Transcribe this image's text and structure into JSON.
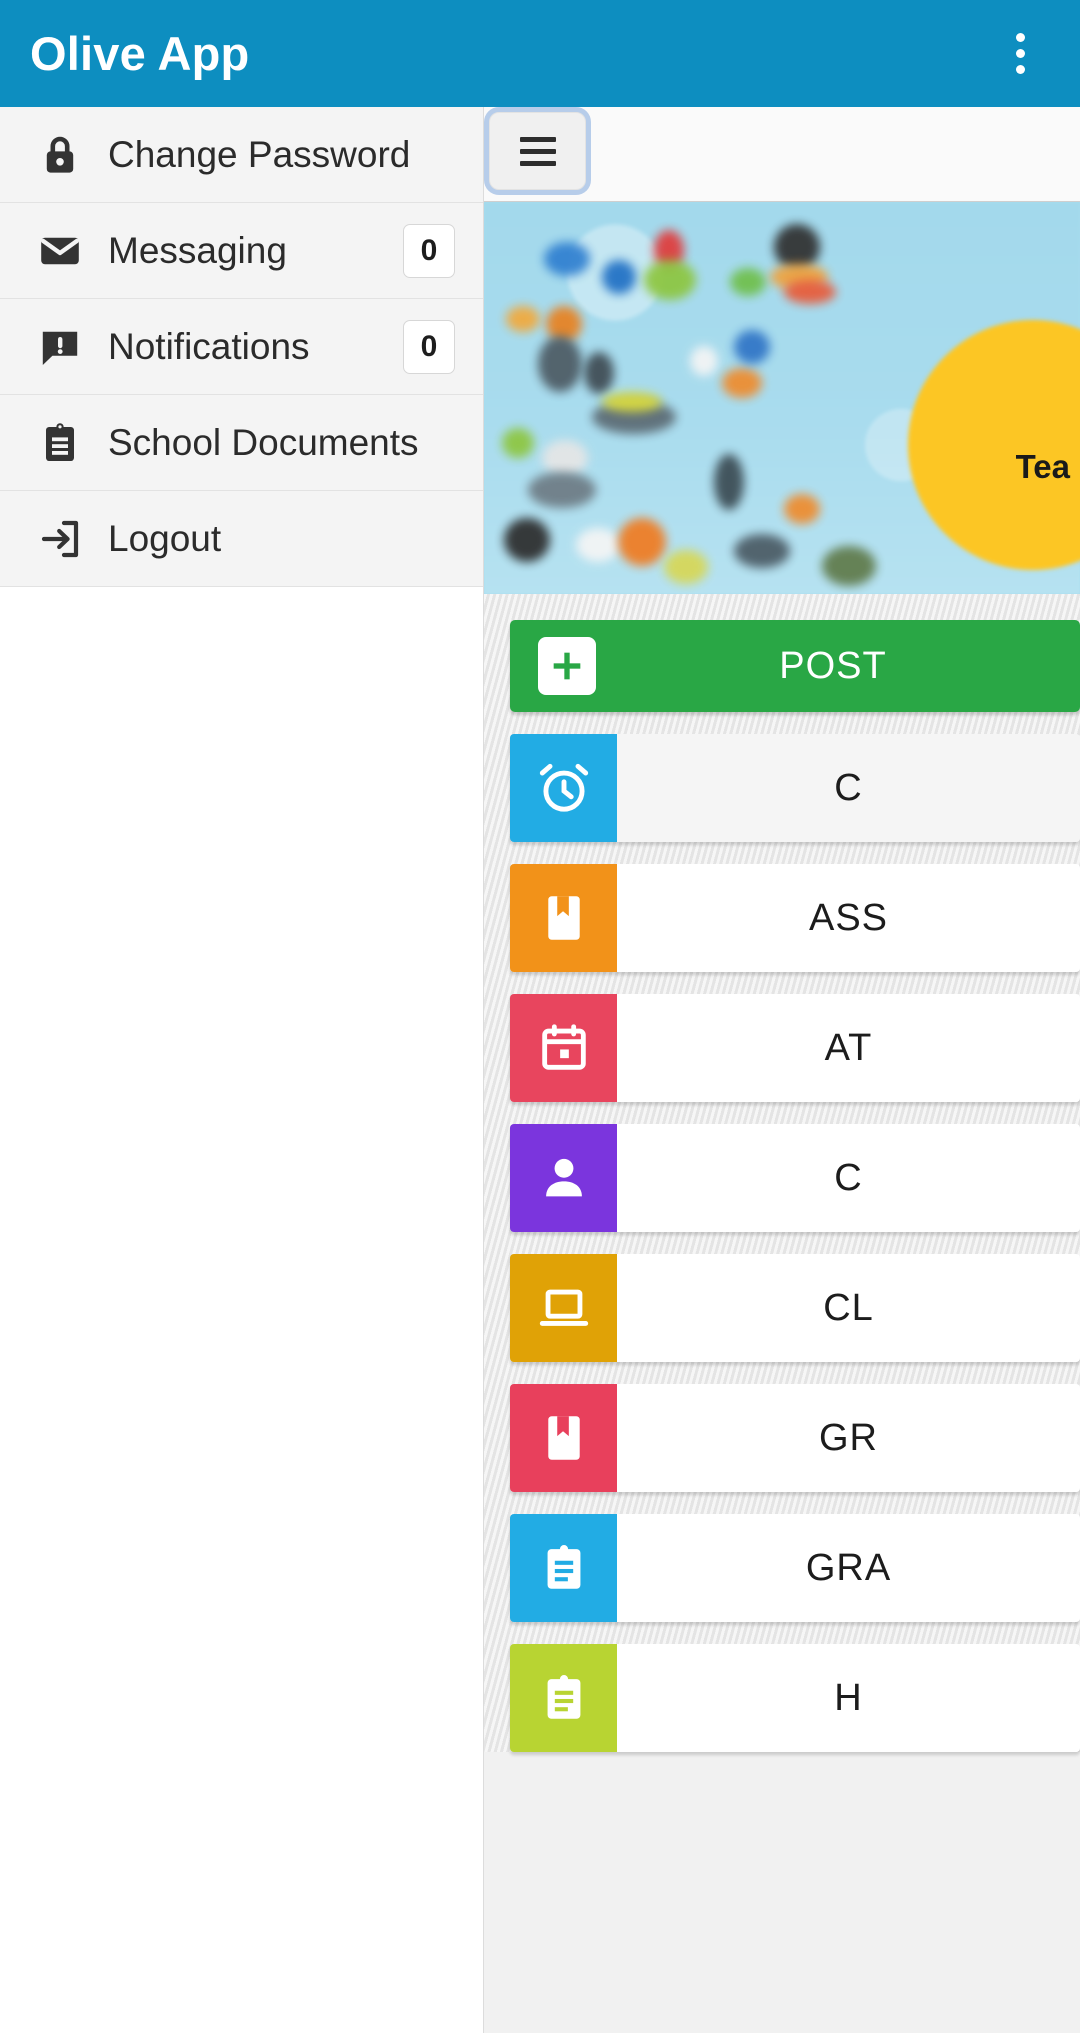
{
  "appbar": {
    "title": "Olive App",
    "overflow_label": "More options"
  },
  "drawer": {
    "items": [
      {
        "label": "Change Password",
        "icon": "lock-icon",
        "badge": null
      },
      {
        "label": "Messaging",
        "icon": "envelope-icon",
        "badge": "0"
      },
      {
        "label": "Notifications",
        "icon": "notification-bubble-icon",
        "badge": "0"
      },
      {
        "label": "School Documents",
        "icon": "clipboard-icon",
        "badge": null
      },
      {
        "label": "Logout",
        "icon": "logout-arrow-icon",
        "badge": null
      }
    ]
  },
  "content": {
    "hamburger_label": "Menu",
    "banner": {
      "caption": "Tea"
    },
    "post_button": {
      "label": "POST",
      "icon": "plus-square-icon",
      "color": "#29a745"
    },
    "tiles": [
      {
        "label": "C",
        "icon": "alarm-clock-icon",
        "color": "#22ace4"
      },
      {
        "label": "ASS",
        "icon": "book-bookmark-icon",
        "color": "#f29219"
      },
      {
        "label": "AT",
        "icon": "calendar-icon",
        "color": "#e8455e"
      },
      {
        "label": "C",
        "icon": "person-icon",
        "color": "#7b35dd"
      },
      {
        "label": "CL",
        "icon": "laptop-icon",
        "color": "#e0a206"
      },
      {
        "label": "GR",
        "icon": "book-bookmark-icon",
        "color": "#e8405c"
      },
      {
        "label": "GRA",
        "icon": "clipboard-icon",
        "color": "#22ace4"
      },
      {
        "label": "H",
        "icon": "clipboard-icon",
        "color": "#b8d432"
      }
    ]
  },
  "colors": {
    "appbar": "#0d8ec0",
    "drawer_bg": "#f4f4f4",
    "accent_green": "#29a745"
  }
}
